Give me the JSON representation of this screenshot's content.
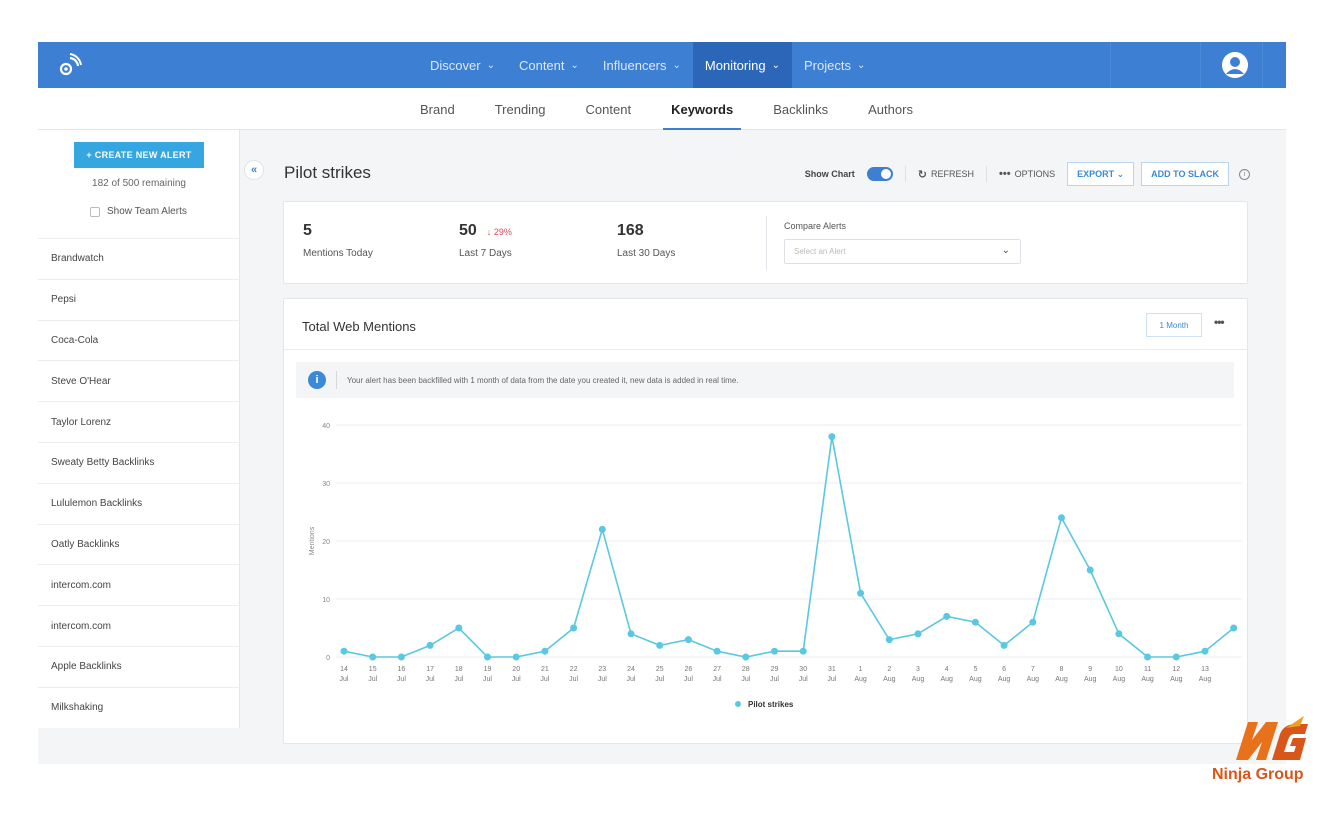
{
  "topnav": {
    "items": [
      {
        "label": "Discover",
        "active": false
      },
      {
        "label": "Content",
        "active": false
      },
      {
        "label": "Influencers",
        "active": false
      },
      {
        "label": "Monitoring",
        "active": true
      },
      {
        "label": "Projects",
        "active": false
      }
    ]
  },
  "subnav": {
    "tabs": [
      {
        "label": "Brand",
        "active": false
      },
      {
        "label": "Trending",
        "active": false
      },
      {
        "label": "Content",
        "active": false
      },
      {
        "label": "Keywords",
        "active": true
      },
      {
        "label": "Backlinks",
        "active": false
      },
      {
        "label": "Authors",
        "active": false
      }
    ]
  },
  "sidebar": {
    "create_label": "+ CREATE NEW ALERT",
    "remaining": "182 of 500 remaining",
    "team_label": "Show Team Alerts",
    "alerts": [
      "Brandwatch",
      "Pepsi",
      "Coca-Cola",
      "Steve O'Hear",
      "Taylor Lorenz",
      "Sweaty Betty Backlinks",
      "Lululemon Backlinks",
      "Oatly Backlinks",
      "intercom.com",
      "intercom.com",
      "Apple Backlinks",
      "Milkshaking"
    ]
  },
  "header": {
    "title": "Pilot strikes",
    "show_chart": "Show Chart",
    "refresh": "REFRESH",
    "options": "OPTIONS",
    "export": "EXPORT",
    "slack": "ADD TO SLACK"
  },
  "stats": {
    "today": {
      "value": "5",
      "label": "Mentions Today"
    },
    "week": {
      "value": "50",
      "change": "29%",
      "label": "Last 7 Days"
    },
    "month": {
      "value": "168",
      "label": "Last 30 Days"
    },
    "compare_label": "Compare Alerts",
    "compare_placeholder": "Select an Alert"
  },
  "chart_card": {
    "title": "Total Web Mentions",
    "range_label": "1 Month",
    "banner": "Your alert has been backfilled with 1 month of data from the date you created it, new data is added in real time."
  },
  "chart_data": {
    "type": "line",
    "ylabel": "Mentions",
    "ylim": [
      0,
      40
    ],
    "yticks": [
      0,
      10,
      20,
      30,
      40
    ],
    "grid": true,
    "legend": "bottom-center",
    "x": [
      {
        "day": "14",
        "month": "Jul"
      },
      {
        "day": "15",
        "month": "Jul"
      },
      {
        "day": "16",
        "month": "Jul"
      },
      {
        "day": "17",
        "month": "Jul"
      },
      {
        "day": "18",
        "month": "Jul"
      },
      {
        "day": "19",
        "month": "Jul"
      },
      {
        "day": "20",
        "month": "Jul"
      },
      {
        "day": "21",
        "month": "Jul"
      },
      {
        "day": "22",
        "month": "Jul"
      },
      {
        "day": "23",
        "month": "Jul"
      },
      {
        "day": "24",
        "month": "Jul"
      },
      {
        "day": "25",
        "month": "Jul"
      },
      {
        "day": "26",
        "month": "Jul"
      },
      {
        "day": "27",
        "month": "Jul"
      },
      {
        "day": "28",
        "month": "Jul"
      },
      {
        "day": "29",
        "month": "Jul"
      },
      {
        "day": "30",
        "month": "Jul"
      },
      {
        "day": "31",
        "month": "Jul"
      },
      {
        "day": "1",
        "month": "Aug"
      },
      {
        "day": "2",
        "month": "Aug"
      },
      {
        "day": "3",
        "month": "Aug"
      },
      {
        "day": "4",
        "month": "Aug"
      },
      {
        "day": "5",
        "month": "Aug"
      },
      {
        "day": "6",
        "month": "Aug"
      },
      {
        "day": "7",
        "month": "Aug"
      },
      {
        "day": "8",
        "month": "Aug"
      },
      {
        "day": "9",
        "month": "Aug"
      },
      {
        "day": "10",
        "month": "Aug"
      },
      {
        "day": "11",
        "month": "Aug"
      },
      {
        "day": "12",
        "month": "Aug"
      },
      {
        "day": "13",
        "month": "Aug"
      }
    ],
    "series": [
      {
        "name": "Pilot strikes",
        "color": "#5ac8e0",
        "values": [
          1,
          0,
          0,
          2,
          5,
          0,
          0,
          1,
          5,
          22,
          4,
          2,
          3,
          1,
          0,
          1,
          1,
          38,
          11,
          3,
          4,
          7,
          6,
          2,
          6,
          24,
          15,
          4,
          0,
          0,
          1,
          5
        ]
      }
    ]
  },
  "watermark": {
    "text": "Ninja Group"
  },
  "colors": {
    "primary": "#3d7fd2",
    "accent": "#36a6e0",
    "series": "#5ac8e0",
    "negative": "#e0475a"
  }
}
